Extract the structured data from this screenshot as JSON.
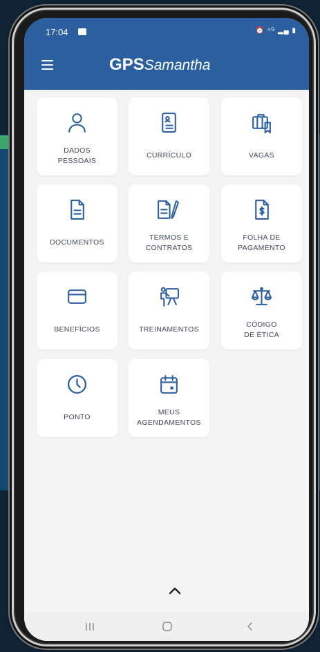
{
  "status": {
    "time": "17:04",
    "icons": "⏰ ⁴ᴳ ▂▄ ▮"
  },
  "brand": {
    "gps": "GPS",
    "name": "Samantha"
  },
  "cards": [
    {
      "label": "DADOS\nPESSOAIS",
      "icon": "user-icon"
    },
    {
      "label": "CURRÍCULO",
      "icon": "resume-icon"
    },
    {
      "label": "VAGAS",
      "icon": "briefcase-bookmark-icon"
    },
    {
      "label": "DOCUMENTOS",
      "icon": "document-icon"
    },
    {
      "label": "TERMOS E\nCONTRATOS",
      "icon": "document-pen-icon"
    },
    {
      "label": "FOLHA DE\nPAGAMENTO",
      "icon": "payroll-icon"
    },
    {
      "label": "BENEFÍCIOS",
      "icon": "card-icon"
    },
    {
      "label": "TREINAMENTOS",
      "icon": "training-icon"
    },
    {
      "label": "CÓDIGO\nDE ÉTICA",
      "icon": "scale-icon"
    },
    {
      "label": "PONTO",
      "icon": "clock-icon"
    },
    {
      "label": "MEUS\nAGENDAMENTOS",
      "icon": "calendar-icon"
    }
  ],
  "colors": {
    "accent": "#2b5f9f",
    "card_bg": "#ffffff",
    "icon": "#2b5f9f"
  }
}
